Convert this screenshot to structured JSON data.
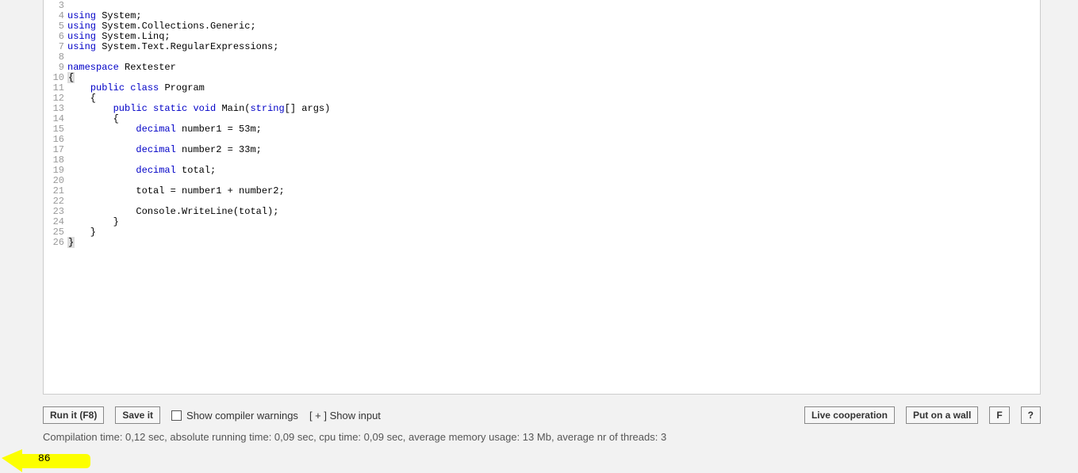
{
  "code": {
    "lines": [
      {
        "n": 3,
        "tokens": []
      },
      {
        "n": 4,
        "tokens": [
          {
            "cls": "kw",
            "t": "using"
          },
          {
            "cls": "plain",
            "t": " System;"
          }
        ]
      },
      {
        "n": 5,
        "tokens": [
          {
            "cls": "kw",
            "t": "using"
          },
          {
            "cls": "plain",
            "t": " System.Collections.Generic;"
          }
        ]
      },
      {
        "n": 6,
        "tokens": [
          {
            "cls": "kw",
            "t": "using"
          },
          {
            "cls": "plain",
            "t": " System.Linq;"
          }
        ]
      },
      {
        "n": 7,
        "tokens": [
          {
            "cls": "kw",
            "t": "using"
          },
          {
            "cls": "plain",
            "t": " System.Text.RegularExpressions;"
          }
        ]
      },
      {
        "n": 8,
        "tokens": []
      },
      {
        "n": 9,
        "tokens": [
          {
            "cls": "kw",
            "t": "namespace"
          },
          {
            "cls": "plain",
            "t": " Rextester"
          }
        ]
      },
      {
        "n": 10,
        "tokens": [
          {
            "cls": "hl",
            "t": "{"
          }
        ]
      },
      {
        "n": 11,
        "tokens": [
          {
            "cls": "plain",
            "t": "    "
          },
          {
            "cls": "kw",
            "t": "public"
          },
          {
            "cls": "plain",
            "t": " "
          },
          {
            "cls": "kw",
            "t": "class"
          },
          {
            "cls": "plain",
            "t": " Program"
          }
        ]
      },
      {
        "n": 12,
        "tokens": [
          {
            "cls": "plain",
            "t": "    {"
          }
        ]
      },
      {
        "n": 13,
        "tokens": [
          {
            "cls": "plain",
            "t": "        "
          },
          {
            "cls": "kw",
            "t": "public"
          },
          {
            "cls": "plain",
            "t": " "
          },
          {
            "cls": "kw",
            "t": "static"
          },
          {
            "cls": "plain",
            "t": " "
          },
          {
            "cls": "kw",
            "t": "void"
          },
          {
            "cls": "plain",
            "t": " Main("
          },
          {
            "cls": "kw",
            "t": "string"
          },
          {
            "cls": "plain",
            "t": "[] args)"
          }
        ]
      },
      {
        "n": 14,
        "tokens": [
          {
            "cls": "plain",
            "t": "        {"
          }
        ]
      },
      {
        "n": 15,
        "tokens": [
          {
            "cls": "plain",
            "t": "            "
          },
          {
            "cls": "kw",
            "t": "decimal"
          },
          {
            "cls": "plain",
            "t": " number1 = 53m;"
          }
        ]
      },
      {
        "n": 16,
        "tokens": []
      },
      {
        "n": 17,
        "tokens": [
          {
            "cls": "plain",
            "t": "            "
          },
          {
            "cls": "kw",
            "t": "decimal"
          },
          {
            "cls": "plain",
            "t": " number2 = 33m;"
          }
        ]
      },
      {
        "n": 18,
        "tokens": []
      },
      {
        "n": 19,
        "tokens": [
          {
            "cls": "plain",
            "t": "            "
          },
          {
            "cls": "kw",
            "t": "decimal"
          },
          {
            "cls": "plain",
            "t": " total;"
          }
        ]
      },
      {
        "n": 20,
        "tokens": []
      },
      {
        "n": 21,
        "tokens": [
          {
            "cls": "plain",
            "t": "            total = number1 + number2;"
          }
        ]
      },
      {
        "n": 22,
        "tokens": []
      },
      {
        "n": 23,
        "tokens": [
          {
            "cls": "plain",
            "t": "            Console.WriteLine(total);"
          }
        ]
      },
      {
        "n": 24,
        "tokens": [
          {
            "cls": "plain",
            "t": "        }"
          }
        ]
      },
      {
        "n": 25,
        "tokens": [
          {
            "cls": "plain",
            "t": "    }"
          }
        ]
      },
      {
        "n": 26,
        "tokens": [
          {
            "cls": "hl",
            "t": "}"
          }
        ]
      }
    ]
  },
  "toolbar": {
    "run": "Run it (F8)",
    "save": "Save it",
    "show_warnings": "Show compiler warnings",
    "show_input": "[ + ] Show input",
    "live": "Live cooperation",
    "wall": "Put on a wall",
    "f": "F",
    "help": "?"
  },
  "stats": "Compilation time: 0,12 sec, absolute running time: 0,09 sec, cpu time: 0,09 sec, average memory usage: 13 Mb, average nr of threads: 3",
  "output": "86"
}
